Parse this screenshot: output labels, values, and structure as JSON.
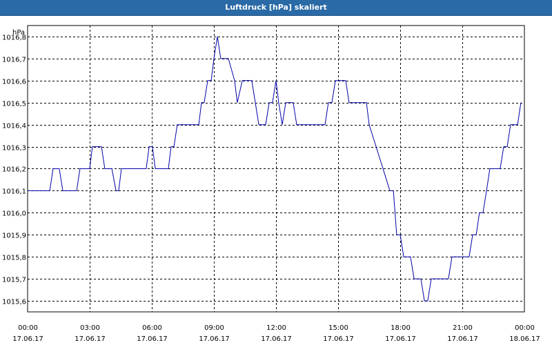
{
  "window": {
    "title": "Luftdruck [hPa] skaliert"
  },
  "chart_data": {
    "type": "line",
    "title": "Luftdruck [hPa] skaliert",
    "unit_label": "hPa",
    "ylim": [
      1015.55,
      1016.85
    ],
    "y_ticks": [
      1016.8,
      1016.7,
      1016.6,
      1016.5,
      1016.4,
      1016.3,
      1016.2,
      1016.1,
      1016.0,
      1015.9,
      1015.8,
      1015.7,
      1015.6
    ],
    "y_tick_labels": [
      "1016,8",
      "1016,7",
      "1016,6",
      "1016,5",
      "1016,4",
      "1016,3",
      "1016,2",
      "1016,1",
      "1016,0",
      "1015,9",
      "1015,8",
      "1015,7",
      "1015,6"
    ],
    "x_range": [
      "17.06.17 00:00",
      "18.06.17 00:00"
    ],
    "x_ticks": [
      {
        "time": "00:00",
        "date": "17.06.17",
        "hour": 0
      },
      {
        "time": "03:00",
        "date": "17.06.17",
        "hour": 3
      },
      {
        "time": "06:00",
        "date": "17.06.17",
        "hour": 6
      },
      {
        "time": "09:00",
        "date": "17.06.17",
        "hour": 9
      },
      {
        "time": "12:00",
        "date": "17.06.17",
        "hour": 12
      },
      {
        "time": "15:00",
        "date": "17.06.17",
        "hour": 15
      },
      {
        "time": "18:00",
        "date": "17.06.17",
        "hour": 18
      },
      {
        "time": "21:00",
        "date": "17.06.17",
        "hour": 21
      },
      {
        "time": "00:00",
        "date": "18.06.17",
        "hour": 24
      }
    ],
    "grid": true,
    "series": [
      {
        "color": "#0000aa",
        "points": [
          [
            0.0,
            1016.1
          ],
          [
            1.07,
            1016.1
          ],
          [
            1.23,
            1016.2
          ],
          [
            1.53,
            1016.2
          ],
          [
            1.7,
            1016.1
          ],
          [
            2.37,
            1016.1
          ],
          [
            2.53,
            1016.2
          ],
          [
            3.0,
            1016.2
          ],
          [
            3.13,
            1016.3
          ],
          [
            3.57,
            1016.3
          ],
          [
            3.73,
            1016.2
          ],
          [
            4.07,
            1016.2
          ],
          [
            4.27,
            1016.1
          ],
          [
            4.4,
            1016.1
          ],
          [
            4.53,
            1016.2
          ],
          [
            5.73,
            1016.2
          ],
          [
            5.87,
            1016.3
          ],
          [
            6.03,
            1016.3
          ],
          [
            6.17,
            1016.2
          ],
          [
            6.8,
            1016.2
          ],
          [
            6.93,
            1016.3
          ],
          [
            7.07,
            1016.3
          ],
          [
            7.23,
            1016.4
          ],
          [
            8.27,
            1016.4
          ],
          [
            8.4,
            1016.5
          ],
          [
            8.53,
            1016.5
          ],
          [
            8.7,
            1016.6
          ],
          [
            8.87,
            1016.6
          ],
          [
            9.0,
            1016.7
          ],
          [
            9.17,
            1016.8
          ],
          [
            9.33,
            1016.7
          ],
          [
            9.7,
            1016.7
          ],
          [
            10.0,
            1016.6
          ],
          [
            10.13,
            1016.5
          ],
          [
            10.37,
            1016.6
          ],
          [
            10.83,
            1016.6
          ],
          [
            11.17,
            1016.4
          ],
          [
            11.5,
            1016.4
          ],
          [
            11.67,
            1016.5
          ],
          [
            11.83,
            1016.5
          ],
          [
            12.0,
            1016.6
          ],
          [
            12.13,
            1016.5
          ],
          [
            12.3,
            1016.4
          ],
          [
            12.47,
            1016.5
          ],
          [
            12.83,
            1016.5
          ],
          [
            13.0,
            1016.4
          ],
          [
            14.37,
            1016.4
          ],
          [
            14.53,
            1016.5
          ],
          [
            14.7,
            1016.5
          ],
          [
            14.87,
            1016.6
          ],
          [
            15.37,
            1016.6
          ],
          [
            15.53,
            1016.5
          ],
          [
            16.37,
            1016.5
          ],
          [
            16.5,
            1016.4
          ],
          [
            17.17,
            1016.2
          ],
          [
            17.5,
            1016.1
          ],
          [
            17.67,
            1016.1
          ],
          [
            17.83,
            1015.9
          ],
          [
            18.0,
            1015.9
          ],
          [
            18.17,
            1015.8
          ],
          [
            18.37,
            1015.8
          ],
          [
            18.5,
            1015.8
          ],
          [
            18.67,
            1015.7
          ],
          [
            19.0,
            1015.7
          ],
          [
            19.17,
            1015.6
          ],
          [
            19.33,
            1015.6
          ],
          [
            19.5,
            1015.7
          ],
          [
            20.33,
            1015.7
          ],
          [
            20.5,
            1015.8
          ],
          [
            21.33,
            1015.8
          ],
          [
            21.5,
            1015.9
          ],
          [
            21.67,
            1015.9
          ],
          [
            21.83,
            1016.0
          ],
          [
            22.0,
            1016.0
          ],
          [
            22.17,
            1016.1
          ],
          [
            22.33,
            1016.2
          ],
          [
            22.83,
            1016.2
          ],
          [
            23.0,
            1016.3
          ],
          [
            23.17,
            1016.3
          ],
          [
            23.33,
            1016.4
          ],
          [
            23.67,
            1016.4
          ],
          [
            23.83,
            1016.5
          ]
        ]
      }
    ]
  }
}
